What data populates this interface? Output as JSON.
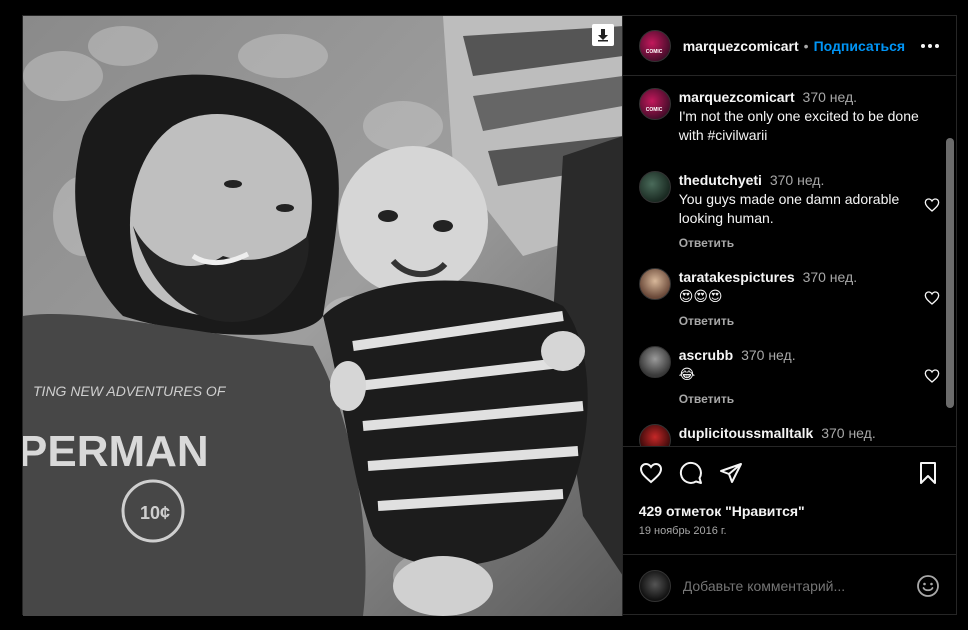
{
  "post": {
    "username": "marquezcomicart",
    "follow_label": "Подписаться",
    "separator": "•",
    "more_icon": "more-horizontal-icon"
  },
  "caption": {
    "username": "marquezcomicart",
    "time": "370 нед.",
    "text": "I'm not the only one excited to be done with #civilwarii"
  },
  "comments": [
    {
      "username": "thedutchyeti",
      "time": "370 нед.",
      "text": "You guys made one damn adorable looking human.",
      "reply": "Ответить"
    },
    {
      "username": "taratakespictures",
      "time": "370 нед.",
      "text": "😍😍😍",
      "reply": "Ответить"
    },
    {
      "username": "ascrubb",
      "time": "370 нед.",
      "text": "😂",
      "reply": "Ответить"
    },
    {
      "username": "duplicitoussmalltalk",
      "time": "370 нед.",
      "text": ""
    }
  ],
  "stats": {
    "likes": "429 отметок \"Нравится\"",
    "date": "19 ноябрь 2016 г."
  },
  "add_comment": {
    "placeholder": "Добавьте комментарий..."
  },
  "colors": {
    "background": "#000000",
    "link": "#0095f6",
    "muted": "#a8a8a8",
    "border": "#262626"
  }
}
